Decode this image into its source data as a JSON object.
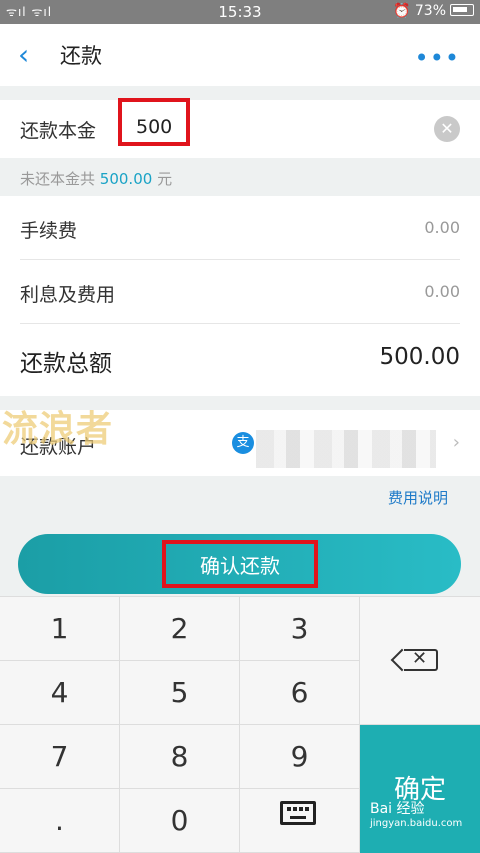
{
  "status_bar": {
    "signal": "ᯤıl ᯤıl",
    "time": "15:33",
    "battery_percent": "⏰ 73%"
  },
  "nav": {
    "back_icon": "‹",
    "title": "还款",
    "more_icon": "•••"
  },
  "amount": {
    "label": "还款本金",
    "value": "500",
    "clear_icon": "✕"
  },
  "hint": {
    "prefix": "未还本金共",
    "amount": "500.00",
    "unit": "元"
  },
  "fees": {
    "handling_label": "手续费",
    "handling_value": "0.00",
    "interest_label": "利息及费用",
    "interest_value": "0.00",
    "total_label": "还款总额",
    "total_value": "500.00"
  },
  "account": {
    "label": "还款账户",
    "icon": "支",
    "arrow": "›"
  },
  "watermark": "流浪者",
  "fee_link": "费用说明",
  "confirm_label": "确认还款",
  "keypad": {
    "k1": "1",
    "k2": "2",
    "k3": "3",
    "k4": "4",
    "k5": "5",
    "k6": "6",
    "k7": "7",
    "k8": "8",
    "k9": "9",
    "dot": ".",
    "k0": "0",
    "delete_icon": "✕",
    "ok": "确定"
  },
  "baidu_watermark": {
    "line1": "Bai 经验",
    "line2": "jingyan.baidu.com"
  }
}
